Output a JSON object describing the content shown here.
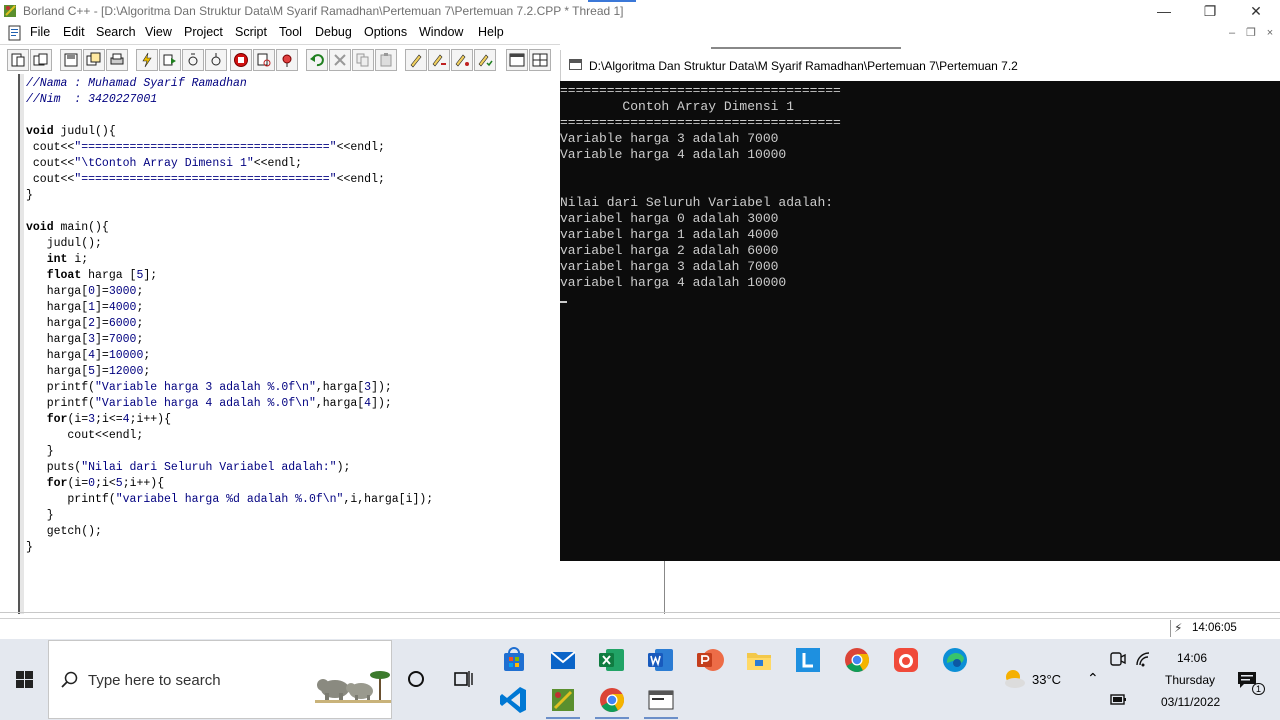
{
  "window": {
    "title": "Borland C++ - [D:\\Algoritma Dan Struktur Data\\M Syarif Ramadhan\\Pertemuan 7\\Pertemuan 7.2.CPP * Thread 1]",
    "controls": {
      "minimize": "—",
      "restore": "❐",
      "close": "✕"
    }
  },
  "menu": {
    "items": [
      "File",
      "Edit",
      "Search",
      "View",
      "Project",
      "Script",
      "Tool",
      "Debug",
      "Options",
      "Window",
      "Help"
    ],
    "mdi_controls": {
      "minimize": "–",
      "restore": "❐",
      "close": "×"
    }
  },
  "toolbar": {
    "buttons": [
      "new-file",
      "open-file",
      "save",
      "save-all",
      "print",
      "cut",
      "copy",
      "paste",
      "make",
      "run",
      "step-over",
      "trace-into",
      "stop",
      "inspect",
      "breakpoint",
      "undo",
      "redo",
      "find",
      "find-next",
      "replace",
      "edit-1",
      "edit-2",
      "edit-3",
      "edit-4",
      "window-cascade",
      "window-tile"
    ]
  },
  "editor": {
    "code_lines": [
      "//Nama : Muhamad Syarif Ramadhan",
      "//Nim  : 3420227001",
      "",
      "void judul(){",
      " cout<<\"====================================\"<<endl;",
      " cout<<\"\\tContoh Array Dimensi 1\"<<endl;",
      " cout<<\"====================================\"<<endl;",
      "}",
      "",
      "void main(){",
      "   judul();",
      "   int i;",
      "   float harga [5];",
      "   harga[0]=3000;",
      "   harga[1]=4000;",
      "   harga[2]=6000;",
      "   harga[3]=7000;",
      "   harga[4]=10000;",
      "   harga[5]=12000;",
      "   printf(\"Variable harga 3 adalah %.0f\\n\",harga[3]);",
      "   printf(\"Variable harga 4 adalah %.0f\\n\",harga[4]);",
      "   for(i=3;i<=4;i++){",
      "      cout<<endl;",
      "   }",
      "   puts(\"Nilai dari Seluruh Variabel adalah:\");",
      "   for(i=0;i<5;i++){",
      "      printf(\"variabel harga %d adalah %.0f\\n\",i,harga[i]);",
      "   }",
      "   getch();",
      "}"
    ]
  },
  "console": {
    "title": "D:\\Algoritma Dan Struktur Data\\M Syarif Ramadhan\\Pertemuan 7\\Pertemuan 7.2",
    "lines": [
      "====================================",
      "        Contoh Array Dimensi 1",
      "====================================",
      "Variable harga 3 adalah 7000",
      "Variable harga 4 adalah 10000",
      "",
      "",
      "Nilai dari Seluruh Variabel adalah:",
      "variabel harga 0 adalah 3000",
      "variabel harga 1 adalah 4000",
      "variabel harga 2 adalah 6000",
      "variabel harga 3 adalah 7000",
      "variabel harga 4 adalah 10000"
    ]
  },
  "statusbar": {
    "time": "14:06:05"
  },
  "taskbar": {
    "search_placeholder": "Type here to search",
    "pinned_apps": [
      "microsoft-store",
      "mail",
      "excel",
      "word",
      "powerpoint",
      "file-explorer",
      "l-app",
      "chrome",
      "app-red",
      "edge"
    ],
    "running_apps": [
      "vscode",
      "borland-cpp",
      "chrome",
      "console-window"
    ],
    "weather": "33°C",
    "clock_time": "14:06",
    "clock_day": "Thursday",
    "clock_date": "03/11/2022",
    "notification_count": "1"
  },
  "colors": {
    "console_bg": "#0c0c0c",
    "console_fg": "#cccccc",
    "keyword": "#000000",
    "string": "#000080",
    "taskbar_bg": "#e4e8ef"
  }
}
